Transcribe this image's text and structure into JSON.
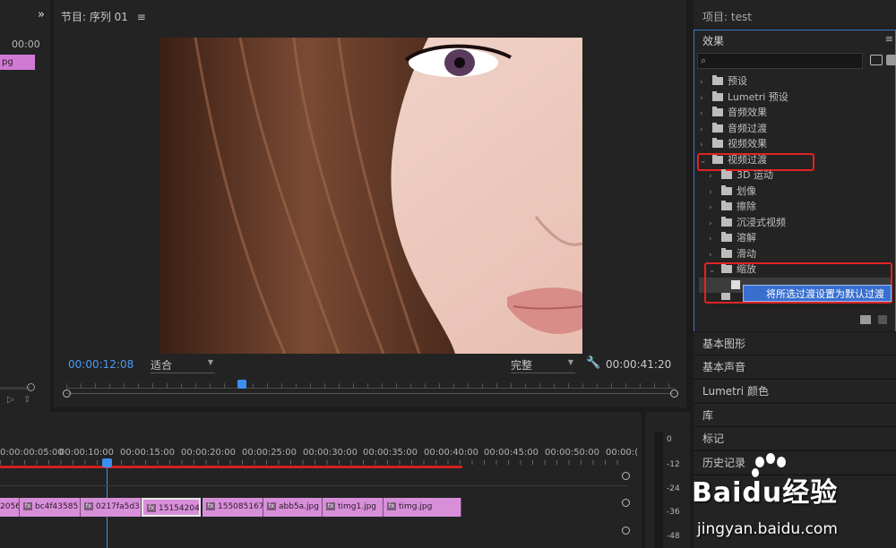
{
  "left_panel": {
    "timecode": "00:00",
    "clip_label": "pg"
  },
  "program_monitor": {
    "title": "节目: 序列 01",
    "current_time": "00:00:12:08",
    "fit_dropdown": "适合",
    "quality_dropdown": "完整",
    "duration": "00:00:41:20"
  },
  "timeline": {
    "ruler": [
      "0:00:00:05:00",
      "00:00:10:00",
      "00:00:15:00",
      "00:00:20:00",
      "00:00:25:00",
      "00:00:30:00",
      "00:00:35:00",
      "00:00:40:00",
      "00:00:45:00",
      "00:00:50:00",
      "00:00:("
    ],
    "clips": [
      "2056",
      "bc4f43585",
      "0217fa5d3",
      "15154204",
      "155085167",
      "abb5a.jpg",
      "timg1.jpg",
      "timg.jpg"
    ],
    "selected_clip_index": 3
  },
  "meters": {
    "labels": [
      "0",
      "-12",
      "-24",
      "-36",
      "-48"
    ]
  },
  "project_panel": {
    "title": "项目: test"
  },
  "effects_panel": {
    "title": "效果",
    "search_placeholder": "",
    "top_items": [
      "预设",
      "Lumetri 预设",
      "音频效果",
      "音频过渡",
      "视频效果",
      "视频过渡"
    ],
    "video_transition_children": [
      "3D 运动",
      "划像",
      "擦除",
      "沉浸式视频",
      "溶解",
      "滑动",
      "缩放"
    ],
    "context_menu_item": "将所选过渡设置为默认过渡"
  },
  "collapsed_panels": [
    "基本图形",
    "基本声音",
    "Lumetri 颜色",
    "库",
    "标记",
    "历史记录"
  ],
  "watermark": {
    "brand": "Baidu经验",
    "url": "jingyan.baidu.com"
  }
}
